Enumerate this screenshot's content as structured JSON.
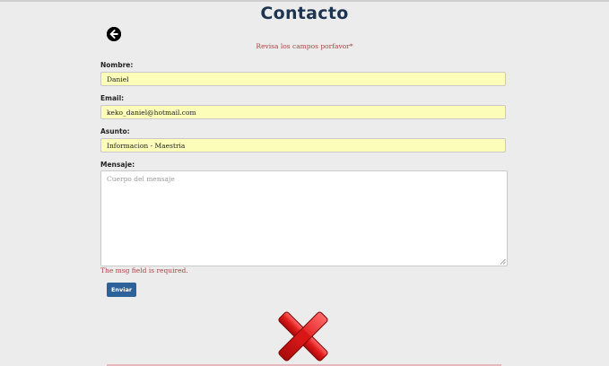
{
  "page": {
    "title": "Contacto",
    "form_error": "Revisa los campos porfavor*"
  },
  "icons": {
    "back": "arrow-left-circle-icon",
    "status": "red-x-icon"
  },
  "form": {
    "nombre": {
      "label": "Nombre:",
      "value": "Daniel"
    },
    "email": {
      "label": "Email:",
      "value": "keko_daniel@hotmail.com"
    },
    "asunto": {
      "label": "Asunto:",
      "value": "Informacion - Maestria"
    },
    "mensaje": {
      "label": "Mensaje:",
      "placeholder": "Cuerpo del mensaje",
      "value": ""
    },
    "mensaje_error": "The msg field is required.",
    "submit_label": "Enviar"
  },
  "colors": {
    "title": "#1c3450",
    "error": "#a94442",
    "input_autofill": "#fbfdb8",
    "button": "#2d6199",
    "x_mark": "#e01a1a"
  }
}
